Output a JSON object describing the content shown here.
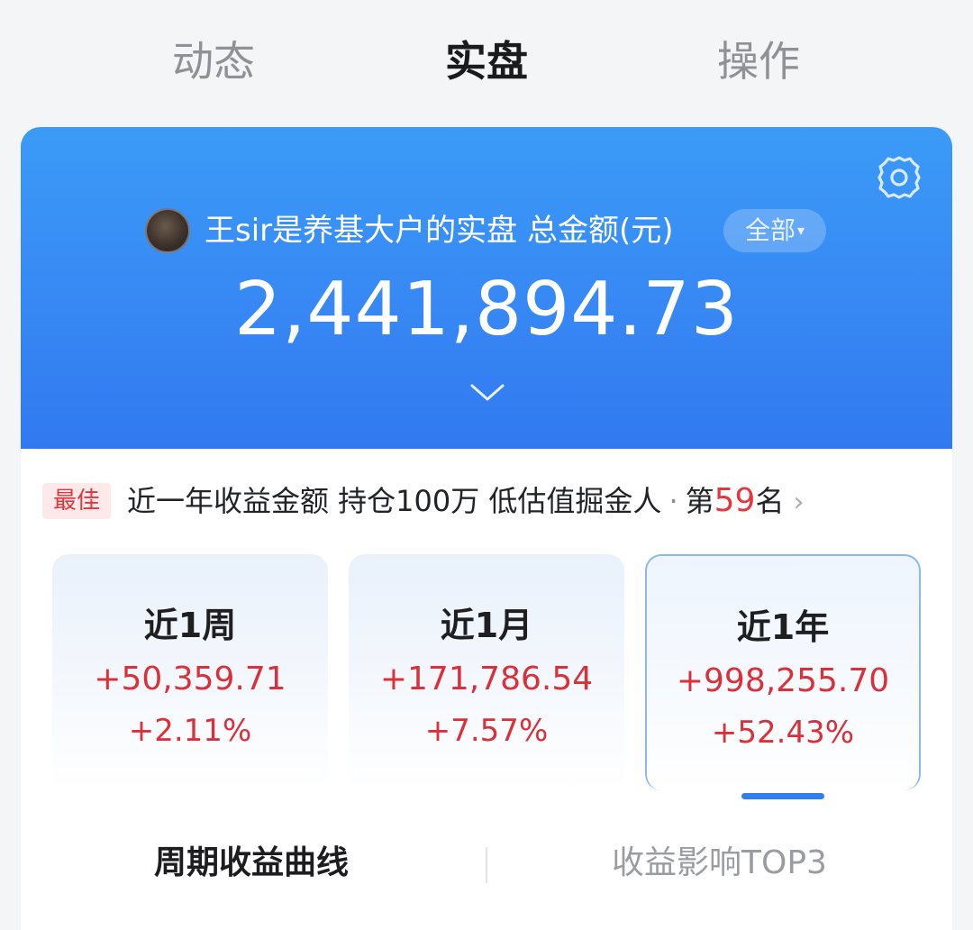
{
  "top_tabs": [
    {
      "label": "动态"
    },
    {
      "label": "实盘",
      "active": true
    },
    {
      "label": "操作"
    }
  ],
  "card": {
    "owner_title": "王sir是养基大户的实盘  总金额(元)",
    "scope_filter": "全部",
    "total_amount": "2,441,894.73",
    "icons": [
      "settings-gear-icon",
      "chevron-down-icon",
      "caret-down-icon"
    ]
  },
  "ranking": {
    "badge": "最佳",
    "text": "近一年收益金额 持仓100万 低估值掘金人",
    "separator": "·",
    "prefix": "第",
    "rank": "59",
    "suffix": "名",
    "arrow": "›"
  },
  "periods": [
    {
      "label": "近1周",
      "amount": "+50,359.71",
      "percent": "+2.11%"
    },
    {
      "label": "近1月",
      "amount": "+171,786.54",
      "percent": "+7.57%"
    },
    {
      "label": "近1年",
      "amount": "+998,255.70",
      "percent": "+52.43%",
      "active": true
    }
  ],
  "bottom_tabs": [
    {
      "label": "周期收益曲线",
      "active": true
    },
    {
      "label": "收益影响TOP3"
    }
  ],
  "colors": {
    "accent_blue": "#2f80ed",
    "gain_red": "#d9303a",
    "card_blue": "#3788f4"
  }
}
